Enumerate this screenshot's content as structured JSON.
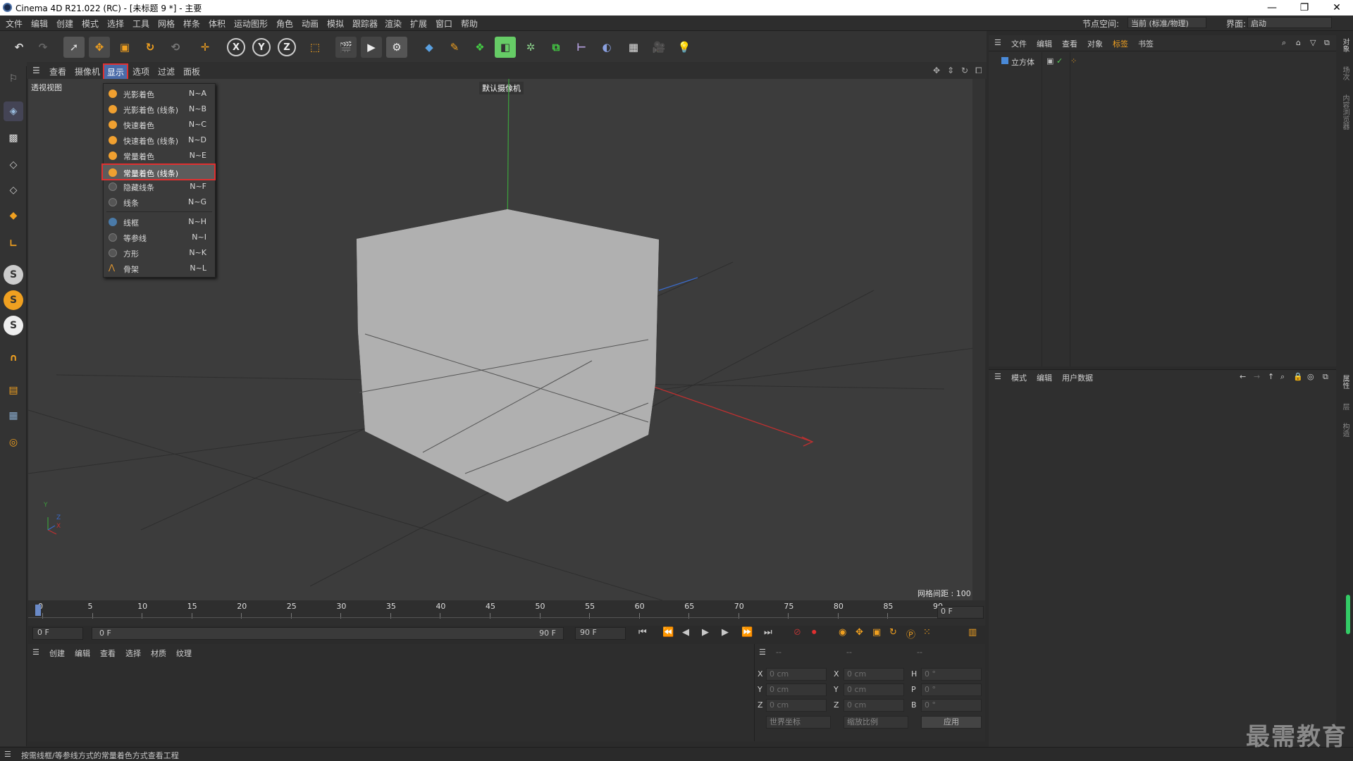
{
  "window": {
    "title": "Cinema 4D R21.022 (RC) - [未标题 9 *] - 主要"
  },
  "menubar": {
    "items": [
      "文件",
      "编辑",
      "创建",
      "模式",
      "选择",
      "工具",
      "网格",
      "样条",
      "体积",
      "运动图形",
      "角色",
      "动画",
      "模拟",
      "跟踪器",
      "渲染",
      "扩展",
      "窗口",
      "帮助"
    ],
    "node_space_label": "节点空间:",
    "node_space_value": "当前 (标准/物理)",
    "layout_label": "界面:",
    "layout_value": "启动"
  },
  "toolbar": {
    "axis_x": "X",
    "axis_y": "Y",
    "axis_z": "Z"
  },
  "viewport_menu": {
    "items": [
      "查看",
      "摄像机",
      "显示",
      "选项",
      "过滤",
      "面板"
    ],
    "active": "显示"
  },
  "viewport": {
    "view_label": "透视视图",
    "camera_label": "默认摄像机",
    "grid_spacing": "网格间距 : 100 cm",
    "axis_y": "Y",
    "axis_z": "Z",
    "axis_x": "X"
  },
  "display_menu": {
    "items": [
      {
        "label": "光影着色",
        "shortcut": "N~A",
        "icon": "orange-shade-icon"
      },
      {
        "label": "光影着色 (线条)",
        "shortcut": "N~B",
        "icon": "orange-shade-lines-icon"
      },
      {
        "label": "快速着色",
        "shortcut": "N~C",
        "icon": "orange-quick-icon"
      },
      {
        "label": "快速着色 (线条)",
        "shortcut": "N~D",
        "icon": "orange-quick-lines-icon"
      },
      {
        "label": "常量着色",
        "shortcut": "N~E",
        "icon": "orange-constant-icon"
      },
      {
        "label": "常量着色 (线条)",
        "shortcut": "",
        "icon": "orange-constant-lines-icon"
      },
      {
        "label": "隐藏线条",
        "shortcut": "N~F",
        "icon": "hidden-lines-icon"
      },
      {
        "label": "线条",
        "shortcut": "N~G",
        "icon": "lines-icon"
      },
      {
        "label": "线框",
        "shortcut": "N~H",
        "icon": "wireframe-icon"
      },
      {
        "label": "等参线",
        "shortcut": "N~I",
        "icon": "isoparm-icon"
      },
      {
        "label": "方形",
        "shortcut": "N~K",
        "icon": "box-icon"
      },
      {
        "label": "骨架",
        "shortcut": "N~L",
        "icon": "skeleton-icon"
      }
    ],
    "highlighted": "常量着色 (线条)"
  },
  "timeline": {
    "ticks": [
      "0",
      "5",
      "10",
      "15",
      "20",
      "25",
      "30",
      "35",
      "40",
      "45",
      "50",
      "55",
      "60",
      "65",
      "70",
      "75",
      "80",
      "85",
      "90"
    ],
    "current_frame": "0 F"
  },
  "playbar": {
    "start_frame": "0 F",
    "range_start": "0 F",
    "range_end": "90 F",
    "end_frame": "90 F"
  },
  "material_panel": {
    "menu": [
      "创建",
      "编辑",
      "查看",
      "选择",
      "材质",
      "纹理"
    ]
  },
  "coord_panel": {
    "header_a": "--",
    "header_b": "--",
    "header_c": "--",
    "rows": [
      {
        "axis": "X",
        "pos": "0 cm",
        "axis2": "X",
        "size": "0 cm",
        "axis3": "H",
        "rot": "0 °"
      },
      {
        "axis": "Y",
        "pos": "0 cm",
        "axis2": "Y",
        "size": "0 cm",
        "axis3": "P",
        "rot": "0 °"
      },
      {
        "axis": "Z",
        "pos": "0 cm",
        "axis2": "Z",
        "size": "0 cm",
        "axis3": "B",
        "rot": "0 °"
      }
    ],
    "coord_mode": "世界坐标",
    "scale_mode": "缩放比例",
    "apply": "应用"
  },
  "object_manager": {
    "menu": [
      "文件",
      "编辑",
      "查看",
      "对象",
      "标签",
      "书签"
    ],
    "objects": [
      {
        "name": "立方体"
      }
    ]
  },
  "attribute_manager": {
    "menu": [
      "模式",
      "编辑",
      "用户数据"
    ]
  },
  "right_strip": {
    "tabs": [
      "对象",
      "场次",
      "内容浏览器",
      "属性",
      "层",
      "构造"
    ]
  },
  "status": {
    "text": "按需线框/等参线方式的常量着色方式查看工程"
  },
  "watermark": "最需教育"
}
